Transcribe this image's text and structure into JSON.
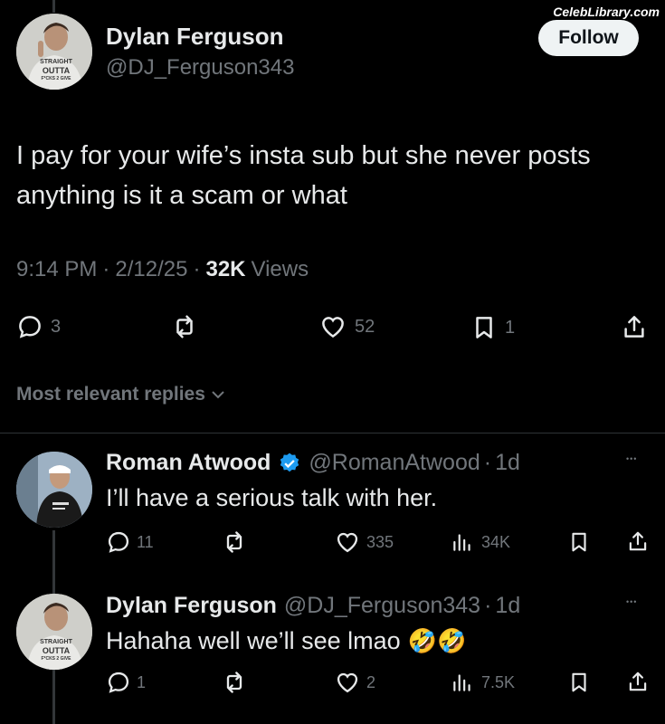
{
  "watermark": "CelebLibrary.com",
  "post": {
    "author_name": "Dylan Ferguson",
    "author_handle": "@DJ_Ferguson343",
    "follow_label": "Follow",
    "avatar_shirt_text": [
      "STRAIGHT",
      "OUTTA",
      "F*CKS 2 GIVE"
    ],
    "text": "I pay for your wife’s insta sub but she never posts anything is it a scam or what",
    "time": "9:14 PM",
    "sep1": "·",
    "date": "2/12/25",
    "sep2": "·",
    "views_count": "32K",
    "views_label": "Views",
    "actions": {
      "replies": "3",
      "likes": "52",
      "bookmarks": "1"
    }
  },
  "replies_header": "Most relevant replies",
  "replies": [
    {
      "author_name": "Roman Atwood",
      "verified": true,
      "author_handle": "@RomanAtwood",
      "sep": "·",
      "age": "1d",
      "text": "I’ll have a serious talk with her.",
      "more": "•••",
      "actions": {
        "replies": "11",
        "likes": "335",
        "views": "34K"
      }
    },
    {
      "author_name": "Dylan Ferguson",
      "author_handle": "@DJ_Ferguson343",
      "sep": "·",
      "age": "1d",
      "text": "Hahaha well we’ll see lmao",
      "emojis": "🤣🤣",
      "more": "•••",
      "actions": {
        "replies": "1",
        "likes": "2",
        "views": "7.5K"
      }
    }
  ],
  "colors": {
    "background": "#000000",
    "text": "#e7e9ea",
    "muted": "#71767b",
    "verified": "#1d9bf0",
    "follow_bg": "#eff3f4"
  }
}
